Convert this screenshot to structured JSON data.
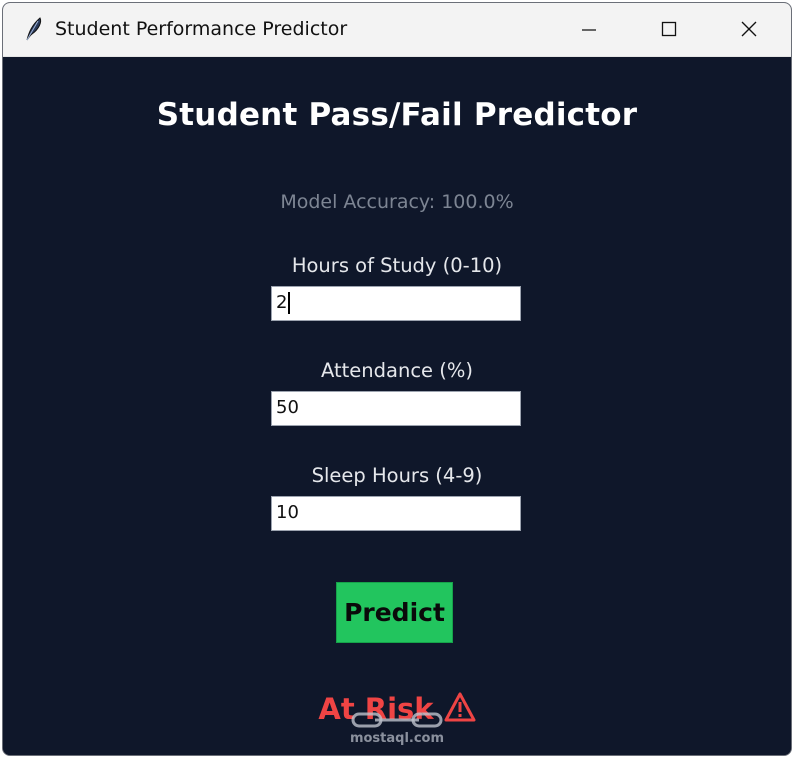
{
  "window": {
    "title": "Student Performance Predictor",
    "app_icon": "feather-icon",
    "controls": [
      "minimize-icon",
      "maximize-icon",
      "close-icon"
    ]
  },
  "main": {
    "heading": "Student Pass/Fail Predictor",
    "accuracy": "Model Accuracy: 100.0%",
    "fields": [
      {
        "label": "Hours of Study (0-10)",
        "value": "2"
      },
      {
        "label": "Attendance (%)",
        "value": "50"
      },
      {
        "label": "Sleep Hours (4-9)",
        "value": "10"
      }
    ],
    "predict_label": "Predict",
    "result_text": "At Risk",
    "result_icon": "warning-icon"
  },
  "watermark": {
    "text": "mostaql.com"
  },
  "colors": {
    "background": "#0f172a",
    "button": "#22c55e",
    "result": "#ef4444",
    "muted_text": "#7d8593"
  }
}
